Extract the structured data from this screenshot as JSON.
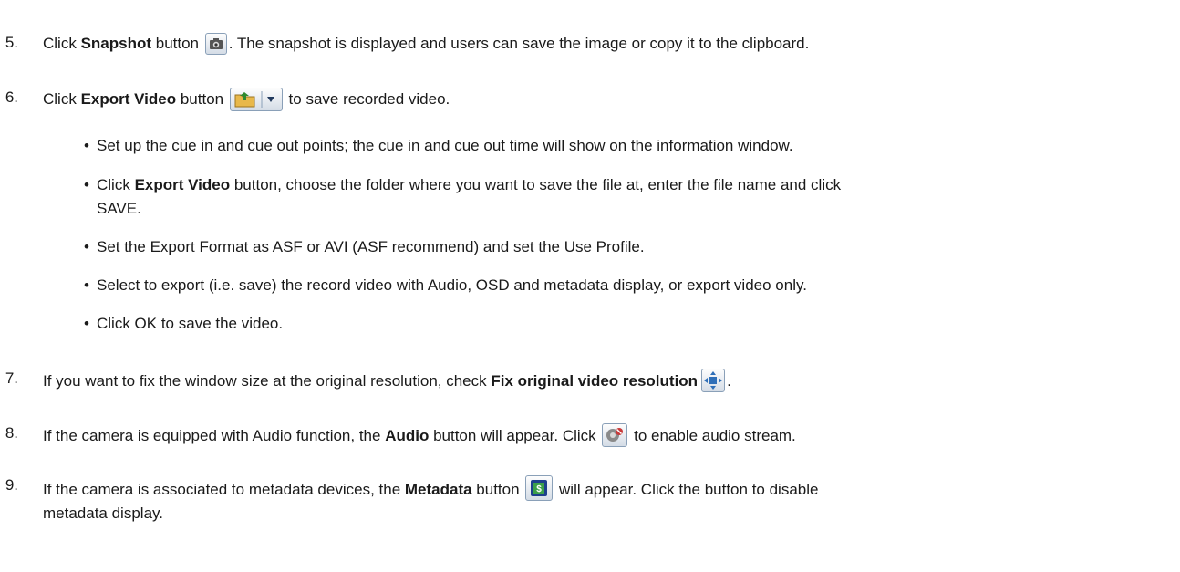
{
  "steps": {
    "s5": {
      "num": "5.",
      "pre": "Click ",
      "bold": "Snapshot",
      "mid": " button ",
      "post": ". The snapshot is displayed and users can save the image or copy it to the clipboard.",
      "icon": "camera-icon"
    },
    "s6": {
      "num": "6.",
      "pre": "Click ",
      "bold": "Export Video",
      "mid": " button ",
      "post": " to save recorded video.",
      "icon": "export-folder-icon"
    },
    "bullets": {
      "b1": "Set up the cue in and cue out points; the cue in and cue out time will show on the information window.",
      "b2_pre": "Click ",
      "b2_bold": "Export Video",
      "b2_post": " button, choose the folder where you want to save the file at, enter the file name and click",
      "b2_cont": "SAVE.",
      "b3": "Set the Export Format as ASF or AVI (ASF recommend) and set the Use Profile.",
      "b4": "Select to export (i.e. save) the record video with Audio, OSD and metadata display, or export video only.",
      "b5": "Click OK to save the video.",
      "bullet_char": "•"
    },
    "s7": {
      "num": "7.",
      "pre": "If you want to fix the window size at the original resolution, check ",
      "bold": "Fix original video resolution",
      "post": ".",
      "icon": "fix-resolution-icon"
    },
    "s8": {
      "num": "8.",
      "pre": "If the camera is equipped with Audio function, the ",
      "bold": "Audio",
      "mid": " button will appear. Click ",
      "post": " to enable audio stream.",
      "icon": "audio-icon"
    },
    "s9": {
      "num": "9.",
      "pre": "If the camera is associated to metadata devices, the ",
      "bold": "Metadata",
      "mid": " button ",
      "post": " will appear. Click the button to disable",
      "cont": "metadata display.",
      "icon": "metadata-icon"
    }
  }
}
